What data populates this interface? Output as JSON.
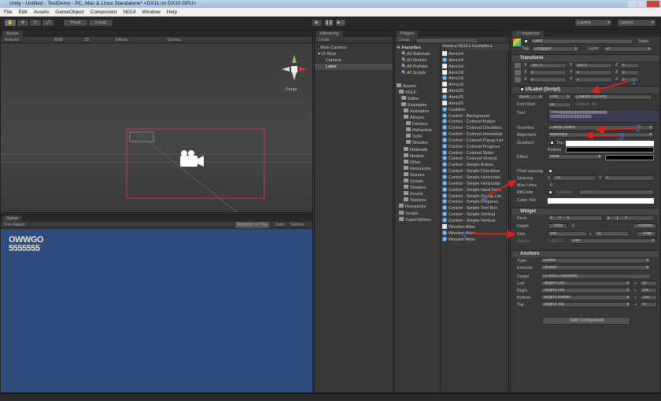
{
  "window": {
    "title": "Unity - Untitled - TestDemo - PC, Mac & Linux Standalone* <DX11 on DX10 GPU>"
  },
  "menu": [
    "File",
    "Edit",
    "Assets",
    "GameObject",
    "Component",
    "NGUI",
    "Window",
    "Help"
  ],
  "toolbar": {
    "pivot": "Pivot",
    "local": "Local",
    "layers": "Layers",
    "layout": "Layout"
  },
  "scene": {
    "tab": "Scene",
    "shading": "Textured",
    "render": "RGB",
    "mode2d": "2D",
    "effects": "Effects",
    "gizmos": "Gizmos",
    "persp": "Persp"
  },
  "game": {
    "tab": "Game",
    "aspect": "Free Aspect",
    "maximize": "Maximize on Play",
    "stats": "Stats",
    "gizmos": "Gizmos",
    "label_text_line1": "OWWGO",
    "label_text_line2": "5555555"
  },
  "hierarchy": {
    "tab": "Hierarchy",
    "create": "Create",
    "items": [
      "Main Camera",
      "UI Root",
      "Camera",
      "Label"
    ]
  },
  "project": {
    "tab": "Project",
    "create": "Create",
    "breadcrumb": "Assets ▸ NGUI ▸ Examples ▸",
    "favorites_label": "Favorites",
    "tree": [
      "All Materials",
      "All Models",
      "All Prefabs",
      "All Scripts",
      "",
      "Assets",
      "NGUI",
      "Editor",
      "Examples",
      "Animation",
      "Atlases",
      "Fantasy",
      "Refractive",
      "SciFi",
      "Wooden",
      "Materials",
      "Models",
      "Other",
      "Resources",
      "Scenes",
      "Scripts",
      "Shaders",
      "Sound",
      "Textures",
      "Resources",
      "Scripts",
      "SuperSplines"
    ],
    "files": [
      "Atmo14",
      "Atmo14",
      "Atmo14",
      "Atmo18",
      "Atmo18",
      "Atmo18",
      "Atmo25",
      "Atmo25",
      "Atmo25",
      "Coalition",
      "Control - Background",
      "Control - Colored Button",
      "Control - Colored Checkbox",
      "Control - Colored Horizontal",
      "Control - Colored Popup List",
      "Control - Colored Progress",
      "Control - Colored Slider",
      "Control - Colored Vertical",
      "Control - Simple Button",
      "Control - Simple Checkbox",
      "Control - Simple Horizontal",
      "Control - Simple Horizontal",
      "Control - Simple Input Field",
      "Control - Simple Popup List",
      "Control - Simple Progress",
      "Control - Simple Text Box",
      "Control - Simple Vertical",
      "Control - Simple Vertical",
      "Wooden Atlas",
      "Wooden Atlas",
      "Wooden Atlas"
    ]
  },
  "inspector": {
    "tab": "Inspector",
    "object_name": "Label",
    "static": "Static",
    "tag_label": "Tag",
    "tag": "Untagged",
    "layer_label": "Layer",
    "layer": "UI",
    "transform": {
      "title": "Transform",
      "pos": [
        "-307.5",
        "161.5",
        "0"
      ],
      "rot": [
        "0",
        "0",
        "0"
      ],
      "scale": [
        "1",
        "1",
        "1"
      ]
    },
    "uilabel": {
      "title": "UILabel (Script)",
      "font_type": "NGUI",
      "font_kind": "Font",
      "font": "Coalition (UIFont)",
      "font_size_label": "Font Size",
      "font_size": "30",
      "default_size": "Default: 48",
      "text_label": "Text",
      "text": "Owwgggggggggggggggggggggg\n5555555555555555555",
      "overflow_label": "Overflow",
      "overflow": "ClampContent",
      "alignment_label": "Alignment",
      "alignment": "Automatic",
      "gradient_label": "Gradient",
      "top_label": "Top",
      "bottom_label": "Bottom",
      "effect_label": "Effect",
      "effect": "None",
      "float_label": "Float spacing",
      "spacing_label": "Spacing",
      "spacing_x": "-10",
      "spacing_y": "0",
      "maxlines_label": "Max Lines",
      "max_lines": "0",
      "bbcode_label": "BBCode",
      "symbols": "Symbols",
      "symbols_mode": "Normal",
      "tint_label": "Color Tint"
    },
    "widget": {
      "title": "Widget",
      "pivot_label": "Pivot",
      "depth_label": "Depth",
      "back": "Back",
      "depth": "0",
      "forward": "Forward",
      "size_label": "Size",
      "width": "140",
      "height": "76",
      "snap": "Snap",
      "aspect_label": "Aspect",
      "aspect_value": "1.84211",
      "aspect_mode": "Free"
    },
    "anchors": {
      "title": "Anchors",
      "type_label": "Type",
      "type": "Unified",
      "execute_label": "Execute",
      "execute": "OnStart",
      "target_label": "Target",
      "target": "UI Root (Transform)",
      "rows": [
        {
          "label": "Left",
          "ref": "Target's Left",
          "value": "19"
        },
        {
          "label": "Right",
          "ref": "Target's Left",
          "value": "159"
        },
        {
          "label": "Bottom",
          "ref": "Target's Bottom",
          "value": "-332"
        },
        {
          "label": "Top",
          "ref": "Target's Top",
          "value": "-9"
        }
      ]
    },
    "add_component": "Add Component"
  },
  "annotations": [
    "1",
    "2",
    "3",
    "4",
    "5"
  ],
  "colors": {
    "arrow": "#e02020",
    "number": "#3a7ad8",
    "game_bg": "#2f4d7c",
    "selection": "#c0306a"
  }
}
